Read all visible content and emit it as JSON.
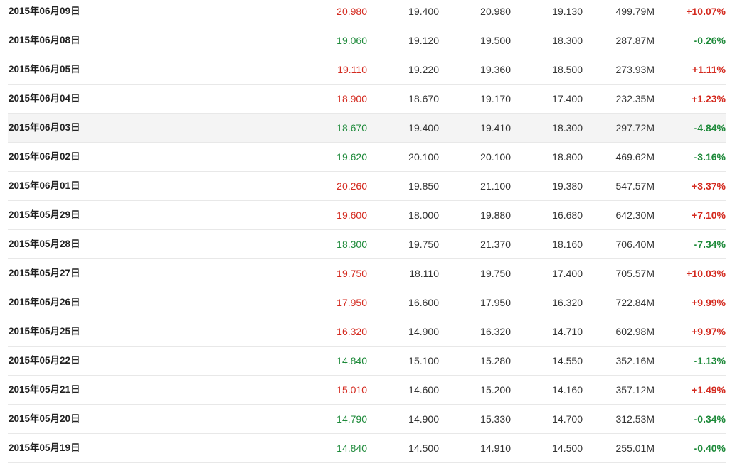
{
  "colors": {
    "up": "#d42a1f",
    "down": "#1e8a3a",
    "text": "#333333",
    "row_highlight": "#f4f4f4",
    "divider": "#e8e8e8"
  },
  "rows": [
    {
      "date": "2015年06月09日",
      "close": "20.980",
      "open": "19.400",
      "high": "20.980",
      "low": "19.130",
      "volume": "499.79M",
      "change": "+10.07%",
      "dir": "up",
      "highlighted": false
    },
    {
      "date": "2015年06月08日",
      "close": "19.060",
      "open": "19.120",
      "high": "19.500",
      "low": "18.300",
      "volume": "287.87M",
      "change": "-0.26%",
      "dir": "down",
      "highlighted": false
    },
    {
      "date": "2015年06月05日",
      "close": "19.110",
      "open": "19.220",
      "high": "19.360",
      "low": "18.500",
      "volume": "273.93M",
      "change": "+1.11%",
      "dir": "up",
      "highlighted": false
    },
    {
      "date": "2015年06月04日",
      "close": "18.900",
      "open": "18.670",
      "high": "19.170",
      "low": "17.400",
      "volume": "232.35M",
      "change": "+1.23%",
      "dir": "up",
      "highlighted": false
    },
    {
      "date": "2015年06月03日",
      "close": "18.670",
      "open": "19.400",
      "high": "19.410",
      "low": "18.300",
      "volume": "297.72M",
      "change": "-4.84%",
      "dir": "down",
      "highlighted": true
    },
    {
      "date": "2015年06月02日",
      "close": "19.620",
      "open": "20.100",
      "high": "20.100",
      "low": "18.800",
      "volume": "469.62M",
      "change": "-3.16%",
      "dir": "down",
      "highlighted": false
    },
    {
      "date": "2015年06月01日",
      "close": "20.260",
      "open": "19.850",
      "high": "21.100",
      "low": "19.380",
      "volume": "547.57M",
      "change": "+3.37%",
      "dir": "up",
      "highlighted": false
    },
    {
      "date": "2015年05月29日",
      "close": "19.600",
      "open": "18.000",
      "high": "19.880",
      "low": "16.680",
      "volume": "642.30M",
      "change": "+7.10%",
      "dir": "up",
      "highlighted": false
    },
    {
      "date": "2015年05月28日",
      "close": "18.300",
      "open": "19.750",
      "high": "21.370",
      "low": "18.160",
      "volume": "706.40M",
      "change": "-7.34%",
      "dir": "down",
      "highlighted": false
    },
    {
      "date": "2015年05月27日",
      "close": "19.750",
      "open": "18.110",
      "high": "19.750",
      "low": "17.400",
      "volume": "705.57M",
      "change": "+10.03%",
      "dir": "up",
      "highlighted": false
    },
    {
      "date": "2015年05月26日",
      "close": "17.950",
      "open": "16.600",
      "high": "17.950",
      "low": "16.320",
      "volume": "722.84M",
      "change": "+9.99%",
      "dir": "up",
      "highlighted": false
    },
    {
      "date": "2015年05月25日",
      "close": "16.320",
      "open": "14.900",
      "high": "16.320",
      "low": "14.710",
      "volume": "602.98M",
      "change": "+9.97%",
      "dir": "up",
      "highlighted": false
    },
    {
      "date": "2015年05月22日",
      "close": "14.840",
      "open": "15.100",
      "high": "15.280",
      "low": "14.550",
      "volume": "352.16M",
      "change": "-1.13%",
      "dir": "down",
      "highlighted": false
    },
    {
      "date": "2015年05月21日",
      "close": "15.010",
      "open": "14.600",
      "high": "15.200",
      "low": "14.160",
      "volume": "357.12M",
      "change": "+1.49%",
      "dir": "up",
      "highlighted": false
    },
    {
      "date": "2015年05月20日",
      "close": "14.790",
      "open": "14.900",
      "high": "15.330",
      "low": "14.700",
      "volume": "312.53M",
      "change": "-0.34%",
      "dir": "down",
      "highlighted": false
    },
    {
      "date": "2015年05月19日",
      "close": "14.840",
      "open": "14.500",
      "high": "14.910",
      "low": "14.500",
      "volume": "255.01M",
      "change": "-0.40%",
      "dir": "down",
      "highlighted": false
    }
  ]
}
